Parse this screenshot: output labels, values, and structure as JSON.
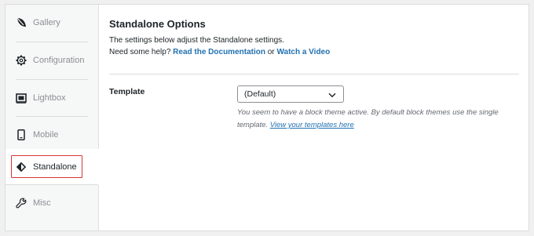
{
  "sidebar": {
    "items": [
      {
        "label": "Gallery",
        "icon": "gallery-leaf-icon"
      },
      {
        "label": "Configuration",
        "icon": "gear-icon"
      },
      {
        "label": "Lightbox",
        "icon": "lightbox-icon"
      },
      {
        "label": "Mobile",
        "icon": "mobile-icon"
      },
      {
        "label": "Standalone",
        "icon": "standalone-diamond-icon",
        "active": true
      },
      {
        "label": "Misc",
        "icon": "wrench-icon"
      }
    ]
  },
  "main": {
    "title": "Standalone Options",
    "description_line1": "The settings below adjust the Standalone settings.",
    "description_line2_prefix": "Need some help?",
    "doc_link": "Read the Documentation",
    "or_text": "or",
    "video_link": "Watch a Video",
    "template": {
      "label": "Template",
      "selected": "(Default)",
      "help_text": "You seem to have a block theme active. By default block themes use the single template.",
      "help_link": "View your templates here"
    }
  },
  "colors": {
    "accent": "#2271b1",
    "highlight_border": "#d63638",
    "muted_text": "#8c8f94"
  }
}
